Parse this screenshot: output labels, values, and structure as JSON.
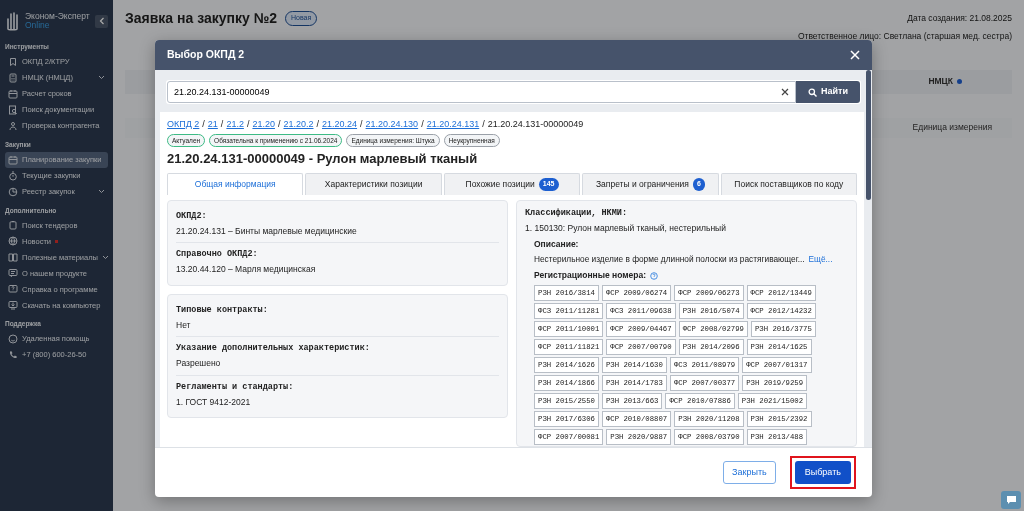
{
  "sidebar": {
    "brand": "Эконом-Эксперт",
    "brand_sub": "Online",
    "sections": [
      {
        "title": "Инструменты",
        "items": [
          {
            "label": "ОКПД 2/КТРУ",
            "selected": false,
            "expandable": false,
            "dot": false
          },
          {
            "label": "НМЦК (НМЦД)",
            "selected": false,
            "expandable": true,
            "dot": false
          },
          {
            "label": "Расчет сроков",
            "selected": false,
            "expandable": false,
            "dot": false
          },
          {
            "label": "Поиск документации",
            "selected": false,
            "expandable": false,
            "dot": false
          },
          {
            "label": "Проверка контрагента",
            "selected": false,
            "expandable": false,
            "dot": false
          }
        ]
      },
      {
        "title": "Закупки",
        "items": [
          {
            "label": "Планирование закупки",
            "selected": true,
            "expandable": false,
            "dot": false
          },
          {
            "label": "Текущие закупки",
            "selected": false,
            "expandable": false,
            "dot": false
          },
          {
            "label": "Реестр закупок",
            "selected": false,
            "expandable": true,
            "dot": false
          }
        ]
      },
      {
        "title": "Дополнительно",
        "items": [
          {
            "label": "Поиск тендеров",
            "selected": false,
            "expandable": false,
            "dot": false
          },
          {
            "label": "Новости",
            "selected": false,
            "expandable": false,
            "dot": true
          },
          {
            "label": "Полезные материалы",
            "selected": false,
            "expandable": true,
            "dot": false
          },
          {
            "label": "О нашем продукте",
            "selected": false,
            "expandable": false,
            "dot": false
          },
          {
            "label": "Справка о программе",
            "selected": false,
            "expandable": false,
            "dot": false
          },
          {
            "label": "Скачать на компьютер",
            "selected": false,
            "expandable": false,
            "dot": false
          }
        ]
      },
      {
        "title": "Поддержка",
        "items": [
          {
            "label": "Удаленная помощь",
            "selected": false,
            "expandable": false,
            "dot": false
          },
          {
            "label": "+7 (800) 600-26-50",
            "selected": false,
            "expandable": false,
            "dot": false
          }
        ]
      }
    ]
  },
  "page": {
    "title": "Заявка на закупку №2",
    "status": "Новая",
    "created": "Дата создания: 21.08.2025",
    "responsible": "Ответственное лицо: Светлана (старшая мед. сестра)",
    "column_1": "НМЦК",
    "column_2": "Единица измерения"
  },
  "modal": {
    "title": "Выбор ОКПД 2",
    "search": {
      "value": "21.20.24.131-00000049"
    },
    "search_button": "Найти",
    "breadcrumb_separator": "/",
    "breadcrumbs": [
      {
        "label": "ОКПД 2",
        "link": true
      },
      {
        "label": "21",
        "link": true
      },
      {
        "label": "21.2",
        "link": true
      },
      {
        "label": "21.20",
        "link": true
      },
      {
        "label": "21.20.2",
        "link": true
      },
      {
        "label": "21.20.24",
        "link": true
      },
      {
        "label": "21.20.24.130",
        "link": true
      },
      {
        "label": "21.20.24.131",
        "link": true
      },
      {
        "label": "21.20.24.131-00000049",
        "link": false
      }
    ],
    "tags": [
      {
        "label": "Актуален",
        "color": "#3dbb85"
      },
      {
        "label": "Обязательна к применению с 21.06.2024",
        "color": "#3dbb85"
      },
      {
        "label": "Единица измерения: Штука",
        "color": "#9aa0a8"
      },
      {
        "label": "Неукрупненная",
        "color": "#9aa0a8"
      }
    ],
    "heading": "21.20.24.131-00000049 - Рулон марлевый тканый",
    "tabs": [
      {
        "label": "Общая информация",
        "selected": true
      },
      {
        "label": "Характеристики позиции",
        "selected": false
      },
      {
        "label": "Похожие позиции",
        "count": "145",
        "selected": false
      },
      {
        "label": "Запреты и ограничения",
        "count": "6",
        "selected": false
      },
      {
        "label": "Поиск поставщиков по коду",
        "selected": false
      }
    ],
    "info_cards": [
      [
        {
          "label": "ОКПД2:",
          "value": "21.20.24.131 – Бинты марлевые медицинские"
        },
        {
          "label": "Справочно ОКПД2:",
          "link": "13.20.44.120",
          "value": " – Марля медицинская"
        }
      ],
      [
        {
          "label": "Типовые контракты:",
          "value": "Нет"
        },
        {
          "label": "Указание дополнительных характеристик:",
          "value": "Разрешено"
        },
        {
          "label": "Регламенты и стандарты:",
          "value": "1. ГОСТ 9412-2021"
        }
      ]
    ],
    "classification": {
      "label": "Классификации, НКМИ:",
      "item": "1. 150130: Рулон марлевый тканый, нестерильный",
      "description_label": "Описание:",
      "description": "Нестерильное изделие в форме длинной полоски из растягивающег...",
      "more": "Ещё...",
      "reg_label": "Регистрационные номера:",
      "reg_numbers": [
        "РЗН 2016/3814",
        "ФСР 2009/06274",
        "ФСР 2009/06273",
        "ФСР 2012/13449",
        "ФСЗ 2011/11281",
        "ФСЗ 2011/09638",
        "РЗН 2016/5074",
        "ФСР 2012/14232",
        "ФСР 2011/10001",
        "ФСР 2009/04467",
        "ФСР 2008/02799",
        "РЗН 2016/3775",
        "ФСР 2011/11821",
        "ФСР 2007/00790",
        "РЗН 2014/2096",
        "РЗН 2014/1625",
        "РЗН 2014/1626",
        "РЗН 2014/1630",
        "ФСЗ 2011/08979",
        "ФСР 2007/01317",
        "РЗН 2014/1866",
        "РЗН 2014/1783",
        "ФСР 2007/00377",
        "РЗН 2019/9259",
        "РЗН 2015/2550",
        "РЗН 2013/663",
        "ФСР 2010/07886",
        "РЗН 2021/15002",
        "РЗН 2017/6306",
        "ФСР 2010/08807",
        "РЗН 2020/11208",
        "РЗН 2015/2392",
        "ФСР 2007/00081",
        "РЗН 2020/9887",
        "ФСР 2008/03790",
        "РЗН 2013/488"
      ]
    },
    "close_button": "Закрыть",
    "select_button": {
      "label": "Выбрать",
      "highlighted": true
    }
  }
}
